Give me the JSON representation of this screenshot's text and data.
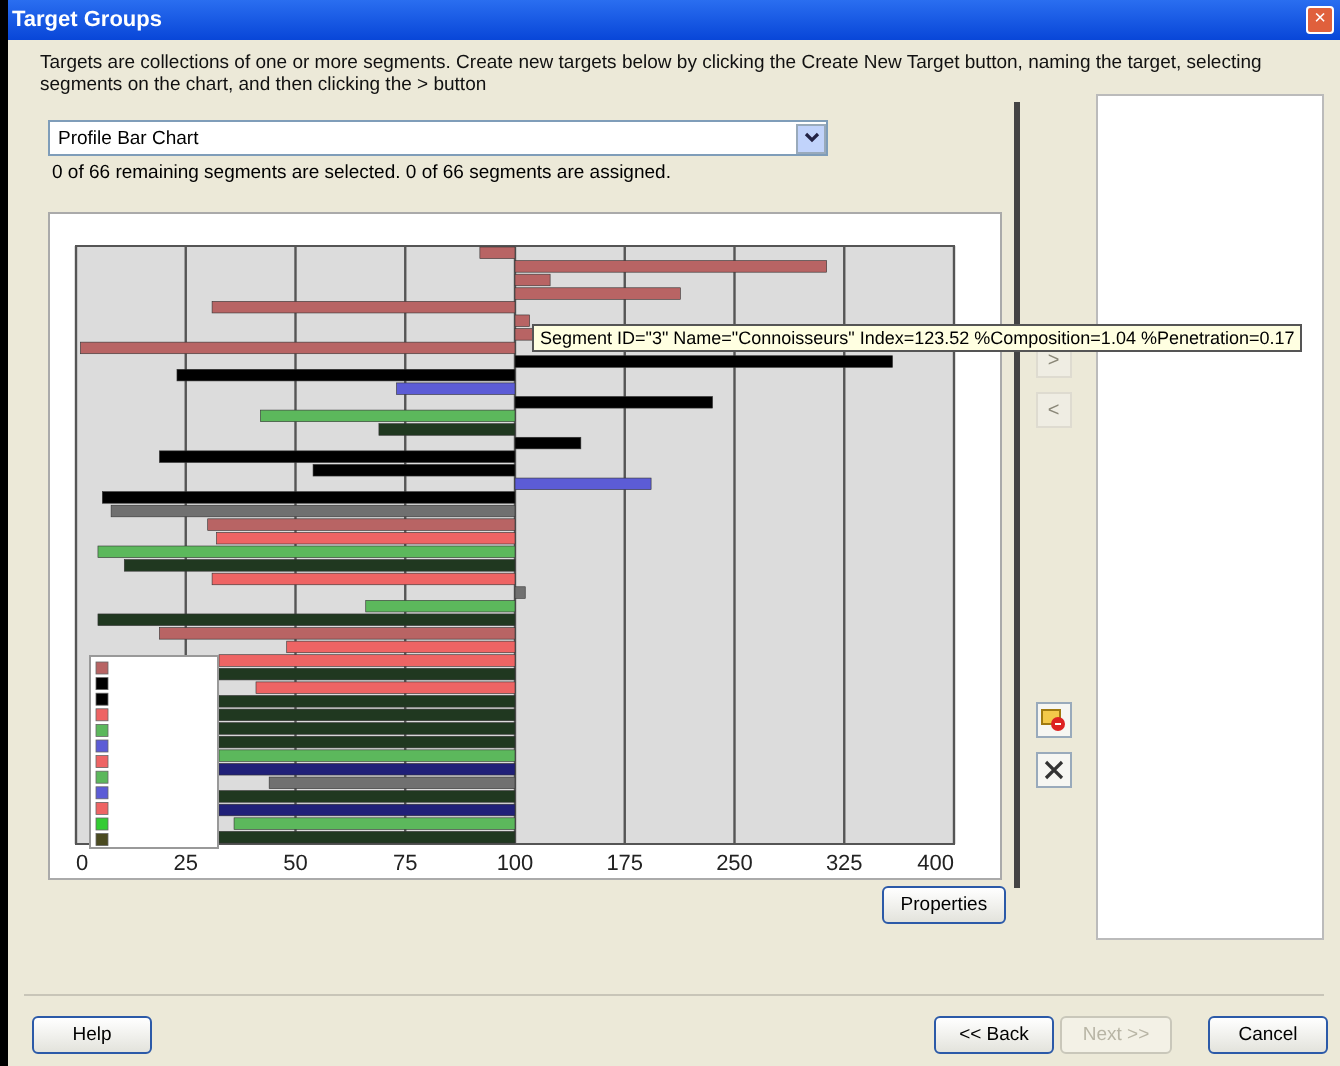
{
  "window": {
    "title": "Target Groups",
    "close": "×"
  },
  "description": "Targets are collections of one or more segments.  Create new targets below by clicking the Create New Target button, naming the target, selecting segments on the chart, and then clicking the > button",
  "chart_selector": {
    "value": "Profile Bar Chart"
  },
  "status": "0 of 66 remaining segments are selected. 0 of 66 segments are assigned.",
  "chart": {
    "axis_labels": [
      "0",
      "25",
      "50",
      "75",
      "100",
      "175",
      "250",
      "325",
      "400"
    ]
  },
  "legend": [
    {
      "color": "#b86464"
    },
    {
      "color": "#000000"
    },
    {
      "color": "#000000"
    },
    {
      "color": "#ee6464"
    },
    {
      "color": "#5cb85c"
    },
    {
      "color": "#5c5cd6"
    },
    {
      "color": "#ee6464"
    },
    {
      "color": "#5cb85c"
    },
    {
      "color": "#5c5cd6"
    },
    {
      "color": "#ee6464"
    },
    {
      "color": "#33cc33"
    },
    {
      "color": "#4a4a20"
    }
  ],
  "tooltip": "Segment ID=\"3\" Name=\"Connoisseurs\" Index=123.52 %Composition=1.04 %Penetration=0.17",
  "properties_button": "Properties",
  "side_buttons": [
    {
      "kind": "text",
      "label": ">",
      "disabled": true
    },
    {
      "kind": "text",
      "label": "<",
      "disabled": true
    },
    {
      "kind": "new-target",
      "disabled": false
    },
    {
      "kind": "delete",
      "disabled": false
    }
  ],
  "buttons": [
    {
      "label": "Help",
      "disabled": false
    },
    {
      "label": "<< Back",
      "disabled": false
    },
    {
      "label": "Next >>",
      "disabled": true
    },
    {
      "label": "Cancel",
      "disabled": false
    }
  ]
}
